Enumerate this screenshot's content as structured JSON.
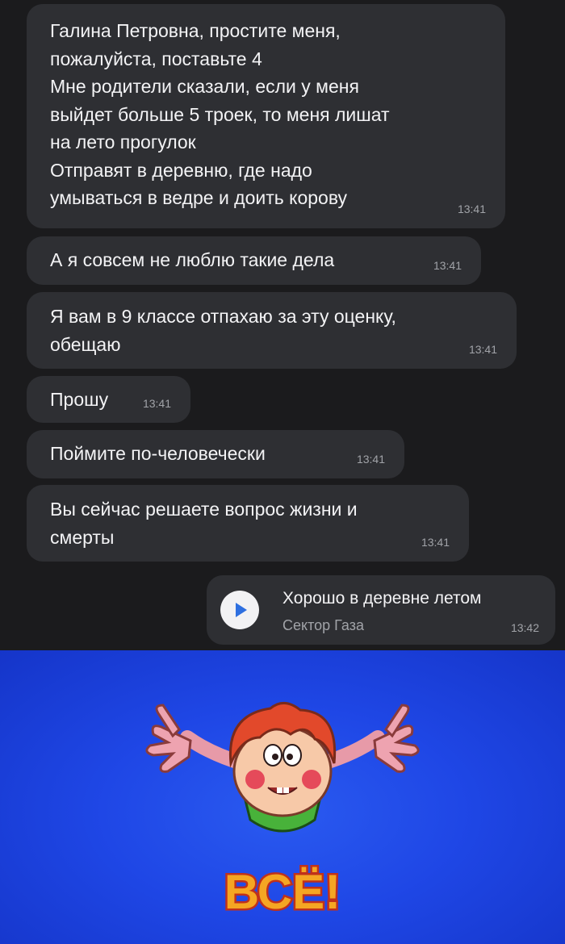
{
  "messages": [
    {
      "text": "Галина Петровна, простите меня,\nпожалуйста, поставьте 4\nМне родители сказали, если у меня\nвыйдет больше 5 троек, то меня лишат\nна лето прогулок\nОтправят в деревню, где надо\nумываться в ведре и доить корову",
      "time": "13:41"
    },
    {
      "text": "А я совсем не люблю такие дела",
      "time": "13:41"
    },
    {
      "text": "Я вам в 9 классе отпахаю за эту оценку,\nобещаю",
      "time": "13:41"
    },
    {
      "text": "Прошу",
      "time": "13:41"
    },
    {
      "text": "Поймите по-человечески",
      "time": "13:41"
    },
    {
      "text": "Вы сейчас решаете вопрос жизни и\nсмерты",
      "time": "13:41"
    }
  ],
  "audio": {
    "title": "Хорошо в деревне летом",
    "artist": "Сектор Газа",
    "time": "13:42",
    "icon": "play-icon"
  },
  "ending_image": {
    "caption": "ВСЁ!",
    "background_color": "#1f47e6"
  }
}
